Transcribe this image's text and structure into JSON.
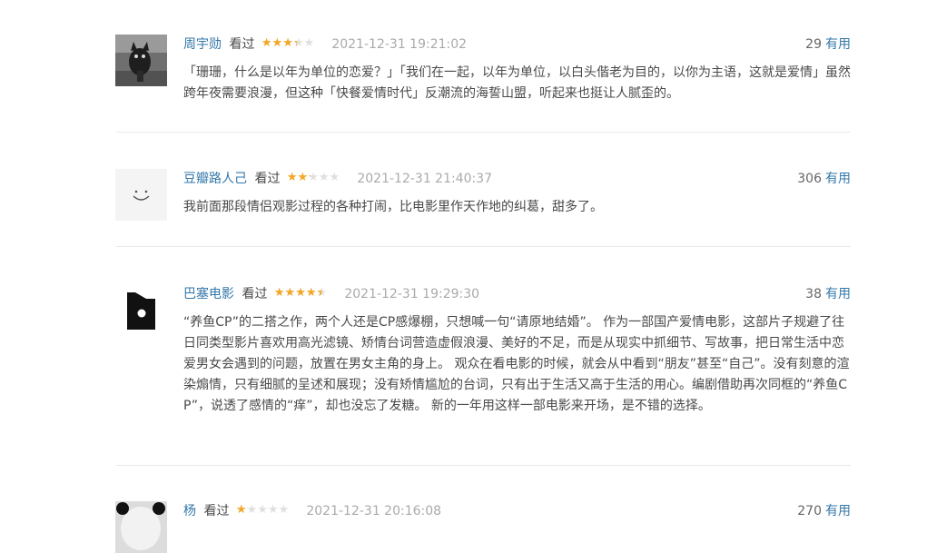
{
  "comments": [
    {
      "user": "周宇勋",
      "seen_label": "看过",
      "rating": 3,
      "time": "2021-12-31 19:21:02",
      "votes": "29",
      "useful_label": "有用",
      "avatar_icon": "cat-photo",
      "text": "「珊珊，什么是以年为单位的恋爱？」「我们在一起，以年为单位，以白头偕老为目的，以你为主语，这就是爱情」虽然跨年夜需要浪漫，但这种「快餐爱情时代」反潮流的海誓山盟，听起来也挺让人腻歪的。"
    },
    {
      "user": "豆瓣路人己",
      "seen_label": "看过",
      "rating": 2,
      "time": "2021-12-31 21:40:37",
      "votes": "306",
      "useful_label": "有用",
      "avatar_icon": "smiley-icon",
      "text": "我前面那段情侣观影过程的各种打闹，比电影里作天作地的纠葛，甜多了。"
    },
    {
      "user": "巴塞电影",
      "seen_label": "看过",
      "rating": 4,
      "time": "2021-12-31 19:29:30",
      "votes": "38",
      "useful_label": "有用",
      "avatar_icon": "flag-logo-icon",
      "text": "“养鱼CP”的二搭之作，两个人还是CP感爆棚，只想喊一句“请原地结婚”。 作为一部国产爱情电影，这部片子规避了往日同类型影片喜欢用高光滤镜、矫情台词营造虚假浪漫、美好的不足，而是从现实中抓细节、写故事，把日常生活中恋爱男女会遇到的问题，放置在男女主角的身上。 观众在看电影的时候，就会从中看到“朋友”甚至“自己”。没有刻意的渲染煽情，只有细腻的呈述和展现；没有矫情尴尬的台词，只有出于生活又高于生活的用心。编剧借助再次同框的“养鱼CP”，说透了感情的“痒”，却也没忘了发糖。 新的一年用这样一部电影来开场，是不错的选择。"
    },
    {
      "user": "杨",
      "seen_label": "看过",
      "rating": 1,
      "time": "2021-12-31 20:16:08",
      "votes": "270",
      "useful_label": "有用",
      "avatar_icon": "panda-photo",
      "text": ""
    }
  ],
  "star_glyphs": "★★★★★",
  "colors": {
    "link": "#3377aa",
    "star": "#f5a623",
    "star_empty": "#e0e0e0",
    "text": "#494949",
    "time": "#aaaaaa"
  }
}
